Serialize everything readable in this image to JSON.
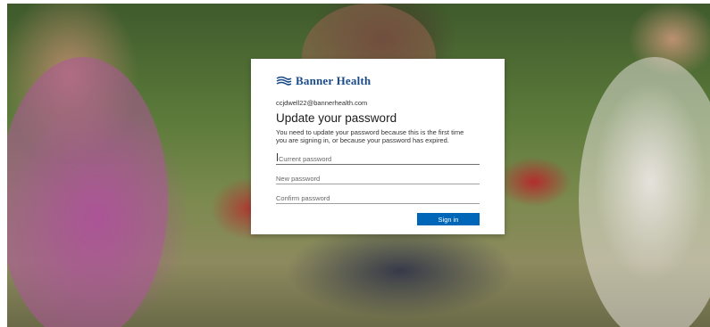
{
  "brand": {
    "name": "Banner Health",
    "icon": "banner-health-logo-icon",
    "color": "#1a4a8a"
  },
  "account": {
    "email": "ccjdwell22@bannerhealth.com"
  },
  "form": {
    "title": "Update your password",
    "description": "You need to update your password because this is the first time you are signing in, or because your password has expired.",
    "current_password_placeholder": "Current password",
    "new_password_placeholder": "New password",
    "confirm_password_placeholder": "Confirm password",
    "submit_label": "Sign in",
    "submit_color": "#0067b8"
  },
  "background": {
    "icon": "background-photo"
  }
}
